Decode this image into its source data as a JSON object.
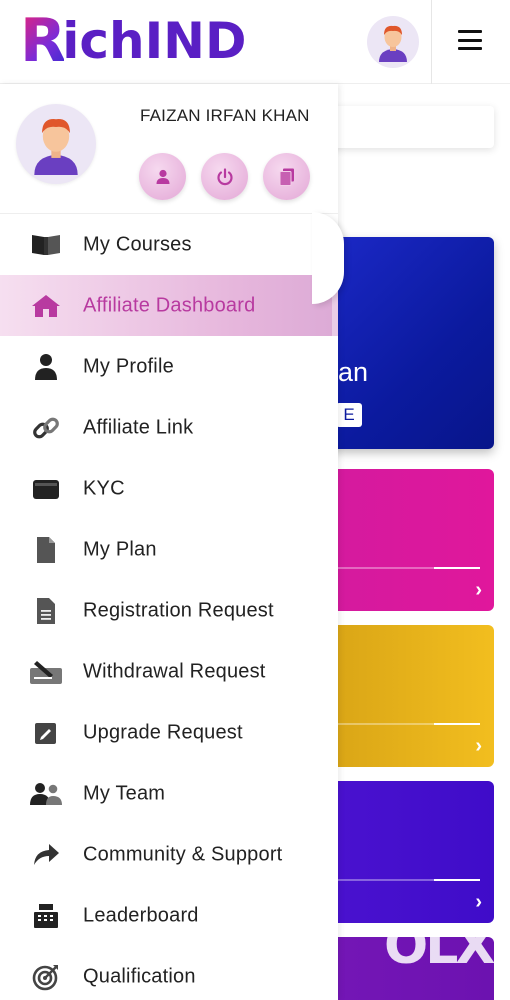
{
  "app": {
    "logo_first": "R",
    "logo_rest": "ichIND"
  },
  "header": {
    "avatar_icon": "user-avatar-icon",
    "menu_icon": "hamburger-icon"
  },
  "background": {
    "card_text": "an",
    "card_pill": "E"
  },
  "watermark": "OLX",
  "profile": {
    "name": "FAIZAN IRFAN KHAN",
    "actions": [
      {
        "name": "profile-action-button",
        "icon": "user-icon"
      },
      {
        "name": "logout-button",
        "icon": "power-icon"
      },
      {
        "name": "copy-button",
        "icon": "copy-icon"
      }
    ]
  },
  "menu": {
    "items": [
      {
        "label": "My Courses",
        "icon": "book-icon"
      },
      {
        "label": "Affiliate Dashboard",
        "icon": "home-icon",
        "active": true
      },
      {
        "label": "My Profile",
        "icon": "user-icon"
      },
      {
        "label": "Affiliate Link",
        "icon": "link-icon"
      },
      {
        "label": "KYC",
        "icon": "wallet-icon"
      },
      {
        "label": "My Plan",
        "icon": "file-icon"
      },
      {
        "label": "Registration Request",
        "icon": "document-icon"
      },
      {
        "label": "Withdrawal Request",
        "icon": "signature-icon"
      },
      {
        "label": "Upgrade Request",
        "icon": "edit-icon"
      },
      {
        "label": "My Team",
        "icon": "users-icon"
      },
      {
        "label": "Community & Support",
        "icon": "share-icon"
      },
      {
        "label": "Leaderboard",
        "icon": "cash-register-icon"
      },
      {
        "label": "Qualification",
        "icon": "target-icon"
      }
    ]
  },
  "colors": {
    "brand": "#5a1fc4",
    "active_text": "#b83aa0",
    "active_bg": "#e6b6dc"
  }
}
